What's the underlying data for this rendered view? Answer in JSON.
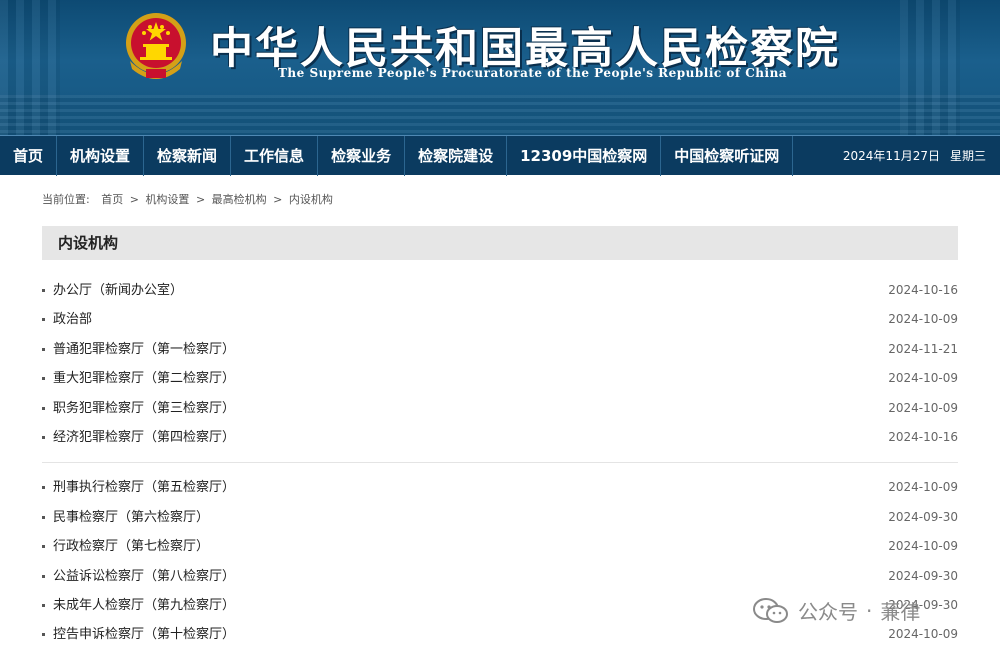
{
  "header": {
    "title_cn": "中华人民共和国最高人民检察院",
    "title_en": "The Supreme People's Procuratorate of the People's Republic of China"
  },
  "nav": {
    "items": [
      "首页",
      "机构设置",
      "检察新闻",
      "工作信息",
      "检察业务",
      "检察院建设",
      "12309中国检察网",
      "中国检察听证网"
    ],
    "date": "2024年11月27日",
    "weekday": "星期三"
  },
  "breadcrumb": {
    "label": "当前位置:",
    "items": [
      "首页",
      "机构设置",
      "最高检机构",
      "内设机构"
    ],
    "separator": ">"
  },
  "section": {
    "title": "内设机构"
  },
  "group1": [
    {
      "name": "办公厅（新闻办公室）",
      "date": "2024-10-16"
    },
    {
      "name": "政治部",
      "date": "2024-10-09"
    },
    {
      "name": "普通犯罪检察厅（第一检察厅）",
      "date": "2024-11-21"
    },
    {
      "name": "重大犯罪检察厅（第二检察厅）",
      "date": "2024-10-09"
    },
    {
      "name": "职务犯罪检察厅（第三检察厅）",
      "date": "2024-10-09"
    },
    {
      "name": "经济犯罪检察厅（第四检察厅）",
      "date": "2024-10-16"
    }
  ],
  "group2": [
    {
      "name": "刑事执行检察厅（第五检察厅）",
      "date": "2024-10-09"
    },
    {
      "name": "民事检察厅（第六检察厅）",
      "date": "2024-09-30"
    },
    {
      "name": "行政检察厅（第七检察厅）",
      "date": "2024-10-09"
    },
    {
      "name": "公益诉讼检察厅（第八检察厅）",
      "date": "2024-09-30"
    },
    {
      "name": "未成年人检察厅（第九检察厅）",
      "date": "2024-09-30"
    },
    {
      "name": "控告申诉检察厅（第十检察厅）",
      "date": "2024-10-09"
    }
  ],
  "watermark": {
    "text1": "公众号",
    "sep": "·",
    "text2": "蒹律"
  },
  "colors": {
    "banner": "#14557f",
    "nav": "#0b3b60",
    "section_bg": "#e6e6e6"
  },
  "icons": {
    "emblem": "national-emblem-icon",
    "wechat": "wechat-icon"
  }
}
